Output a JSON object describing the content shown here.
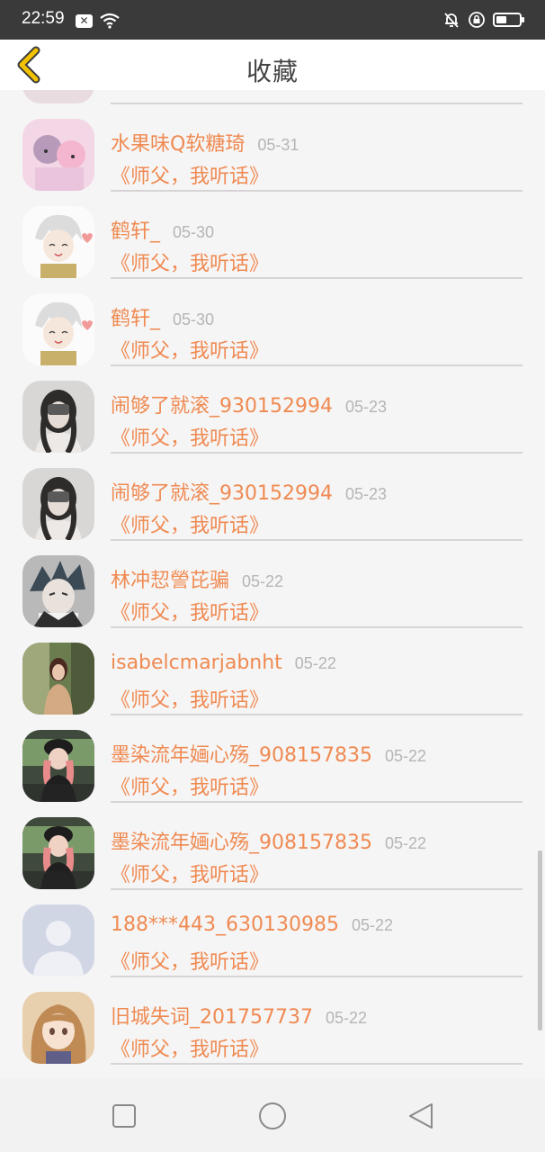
{
  "status_bar": {
    "time": "22:59",
    "battery_level": 0.45
  },
  "header": {
    "title": "收藏"
  },
  "items": [
    {
      "name": "",
      "date": "",
      "book": "",
      "avatar": "generic"
    },
    {
      "name": "水果味Q软糖琦",
      "date": "05-31",
      "book": "《师父，我听话》",
      "avatar": "anime-pink"
    },
    {
      "name": "鹤轩_",
      "date": "05-30",
      "book": "《师父，我听话》",
      "avatar": "anime-white"
    },
    {
      "name": "鹤轩_",
      "date": "05-30",
      "book": "《师父，我听话》",
      "avatar": "anime-white"
    },
    {
      "name": "闹够了就滚_930152994",
      "date": "05-23",
      "book": "《师父，我听话》",
      "avatar": "photo-gray"
    },
    {
      "name": "闹够了就滚_930152994",
      "date": "05-23",
      "book": "《师父，我听话》",
      "avatar": "photo-gray"
    },
    {
      "name": "林冲恝謍芘骗",
      "date": "05-22",
      "book": "《师父，我听话》",
      "avatar": "anime-dark"
    },
    {
      "name": "isabelcmarjabnht",
      "date": "05-22",
      "book": "《师父，我听话》",
      "avatar": "photo-warm"
    },
    {
      "name": "墨染流年婳心殇_908157835",
      "date": "05-22",
      "book": "《师父，我听话》",
      "avatar": "photo-car"
    },
    {
      "name": "墨染流年婳心殇_908157835",
      "date": "05-22",
      "book": "《师父，我听话》",
      "avatar": "photo-car"
    },
    {
      "name": "188***443_630130985",
      "date": "05-22",
      "book": "《师父，我听话》",
      "avatar": "default-blue"
    },
    {
      "name": "旧城失词_201757737",
      "date": "05-22",
      "book": "《师父，我听话》",
      "avatar": "anime-girl"
    },
    {
      "name": "",
      "date": "",
      "book": "",
      "avatar": "photo-warm"
    }
  ],
  "colors": {
    "accent": "#ef8a52",
    "date": "#b5b5b5",
    "background": "#f6f5f5",
    "back_arrow": "#f2c200"
  },
  "icons": {
    "back": "chevron-left-icon",
    "recent": "square-icon",
    "home": "circle-icon",
    "navigate_back": "triangle-back-icon"
  }
}
